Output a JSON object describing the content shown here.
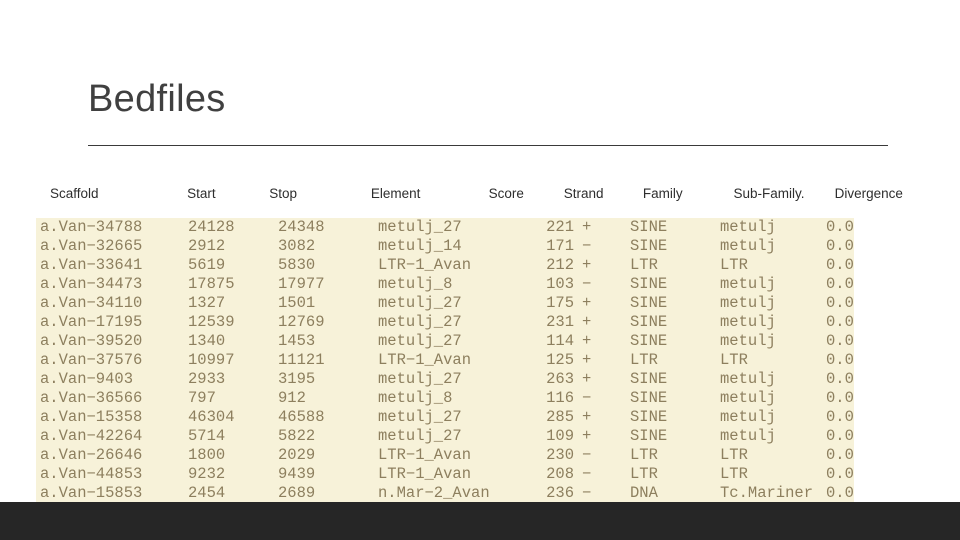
{
  "slide": {
    "title": "Bedfiles",
    "background_color": "#ffffff",
    "title_color": "#404040",
    "data_block_color": "#f7f2d9",
    "data_text_color": "#8d7f5e",
    "footer_color": "#262626"
  },
  "table": {
    "headers": [
      "Scaffold",
      "Start",
      "Stop",
      "Element",
      "Score",
      "Strand",
      "Family",
      "Sub-Family.",
      "Divergence"
    ],
    "rows": [
      {
        "scaffold": "a.Van−34788",
        "start": "24128",
        "stop": "24348",
        "element": "metulj_27",
        "score": "221",
        "strand": "+",
        "family": "SINE",
        "subfamily": "metulj",
        "divergence": "0.0"
      },
      {
        "scaffold": "a.Van−32665",
        "start": "2912",
        "stop": "3082",
        "element": "metulj_14",
        "score": "171",
        "strand": "−",
        "family": "SINE",
        "subfamily": "metulj",
        "divergence": "0.0"
      },
      {
        "scaffold": "a.Van−33641",
        "start": "5619",
        "stop": "5830",
        "element": "LTR−1_Avan",
        "score": "212",
        "strand": "+",
        "family": "LTR",
        "subfamily": "LTR",
        "divergence": "0.0"
      },
      {
        "scaffold": "a.Van−34473",
        "start": "17875",
        "stop": "17977",
        "element": "metulj_8",
        "score": "103",
        "strand": "−",
        "family": "SINE",
        "subfamily": "metulj",
        "divergence": "0.0"
      },
      {
        "scaffold": "a.Van−34110",
        "start": "1327",
        "stop": "1501",
        "element": "metulj_27",
        "score": "175",
        "strand": "+",
        "family": "SINE",
        "subfamily": "metulj",
        "divergence": "0.0"
      },
      {
        "scaffold": "a.Van−17195",
        "start": "12539",
        "stop": "12769",
        "element": "metulj_27",
        "score": "231",
        "strand": "+",
        "family": "SINE",
        "subfamily": "metulj",
        "divergence": "0.0"
      },
      {
        "scaffold": "a.Van−39520",
        "start": "1340",
        "stop": "1453",
        "element": "metulj_27",
        "score": "114",
        "strand": "+",
        "family": "SINE",
        "subfamily": "metulj",
        "divergence": "0.0"
      },
      {
        "scaffold": "a.Van−37576",
        "start": "10997",
        "stop": "11121",
        "element": "LTR−1_Avan",
        "score": "125",
        "strand": "+",
        "family": "LTR",
        "subfamily": "LTR",
        "divergence": "0.0"
      },
      {
        "scaffold": "a.Van−9403",
        "start": "2933",
        "stop": "3195",
        "element": "metulj_27",
        "score": "263",
        "strand": "+",
        "family": "SINE",
        "subfamily": "metulj",
        "divergence": "0.0"
      },
      {
        "scaffold": "a.Van−36566",
        "start": "797",
        "stop": "912",
        "element": "metulj_8",
        "score": "116",
        "strand": "−",
        "family": "SINE",
        "subfamily": "metulj",
        "divergence": "0.0"
      },
      {
        "scaffold": "a.Van−15358",
        "start": "46304",
        "stop": "46588",
        "element": "metulj_27",
        "score": "285",
        "strand": "+",
        "family": "SINE",
        "subfamily": "metulj",
        "divergence": "0.0"
      },
      {
        "scaffold": "a.Van−42264",
        "start": "5714",
        "stop": "5822",
        "element": "metulj_27",
        "score": "109",
        "strand": "+",
        "family": "SINE",
        "subfamily": "metulj",
        "divergence": "0.0"
      },
      {
        "scaffold": "a.Van−26646",
        "start": "1800",
        "stop": "2029",
        "element": "LTR−1_Avan",
        "score": "230",
        "strand": "−",
        "family": "LTR",
        "subfamily": "LTR",
        "divergence": "0.0"
      },
      {
        "scaffold": "a.Van−44853",
        "start": "9232",
        "stop": "9439",
        "element": "LTR−1_Avan",
        "score": "208",
        "strand": "−",
        "family": "LTR",
        "subfamily": "LTR",
        "divergence": "0.0"
      },
      {
        "scaffold": "a.Van−15853",
        "start": "2454",
        "stop": "2689",
        "element": "n.Mar−2_Avan",
        "score": "236",
        "strand": "−",
        "family": "DNA",
        "subfamily": "Tc.Mariner",
        "divergence": "0.0"
      }
    ]
  }
}
